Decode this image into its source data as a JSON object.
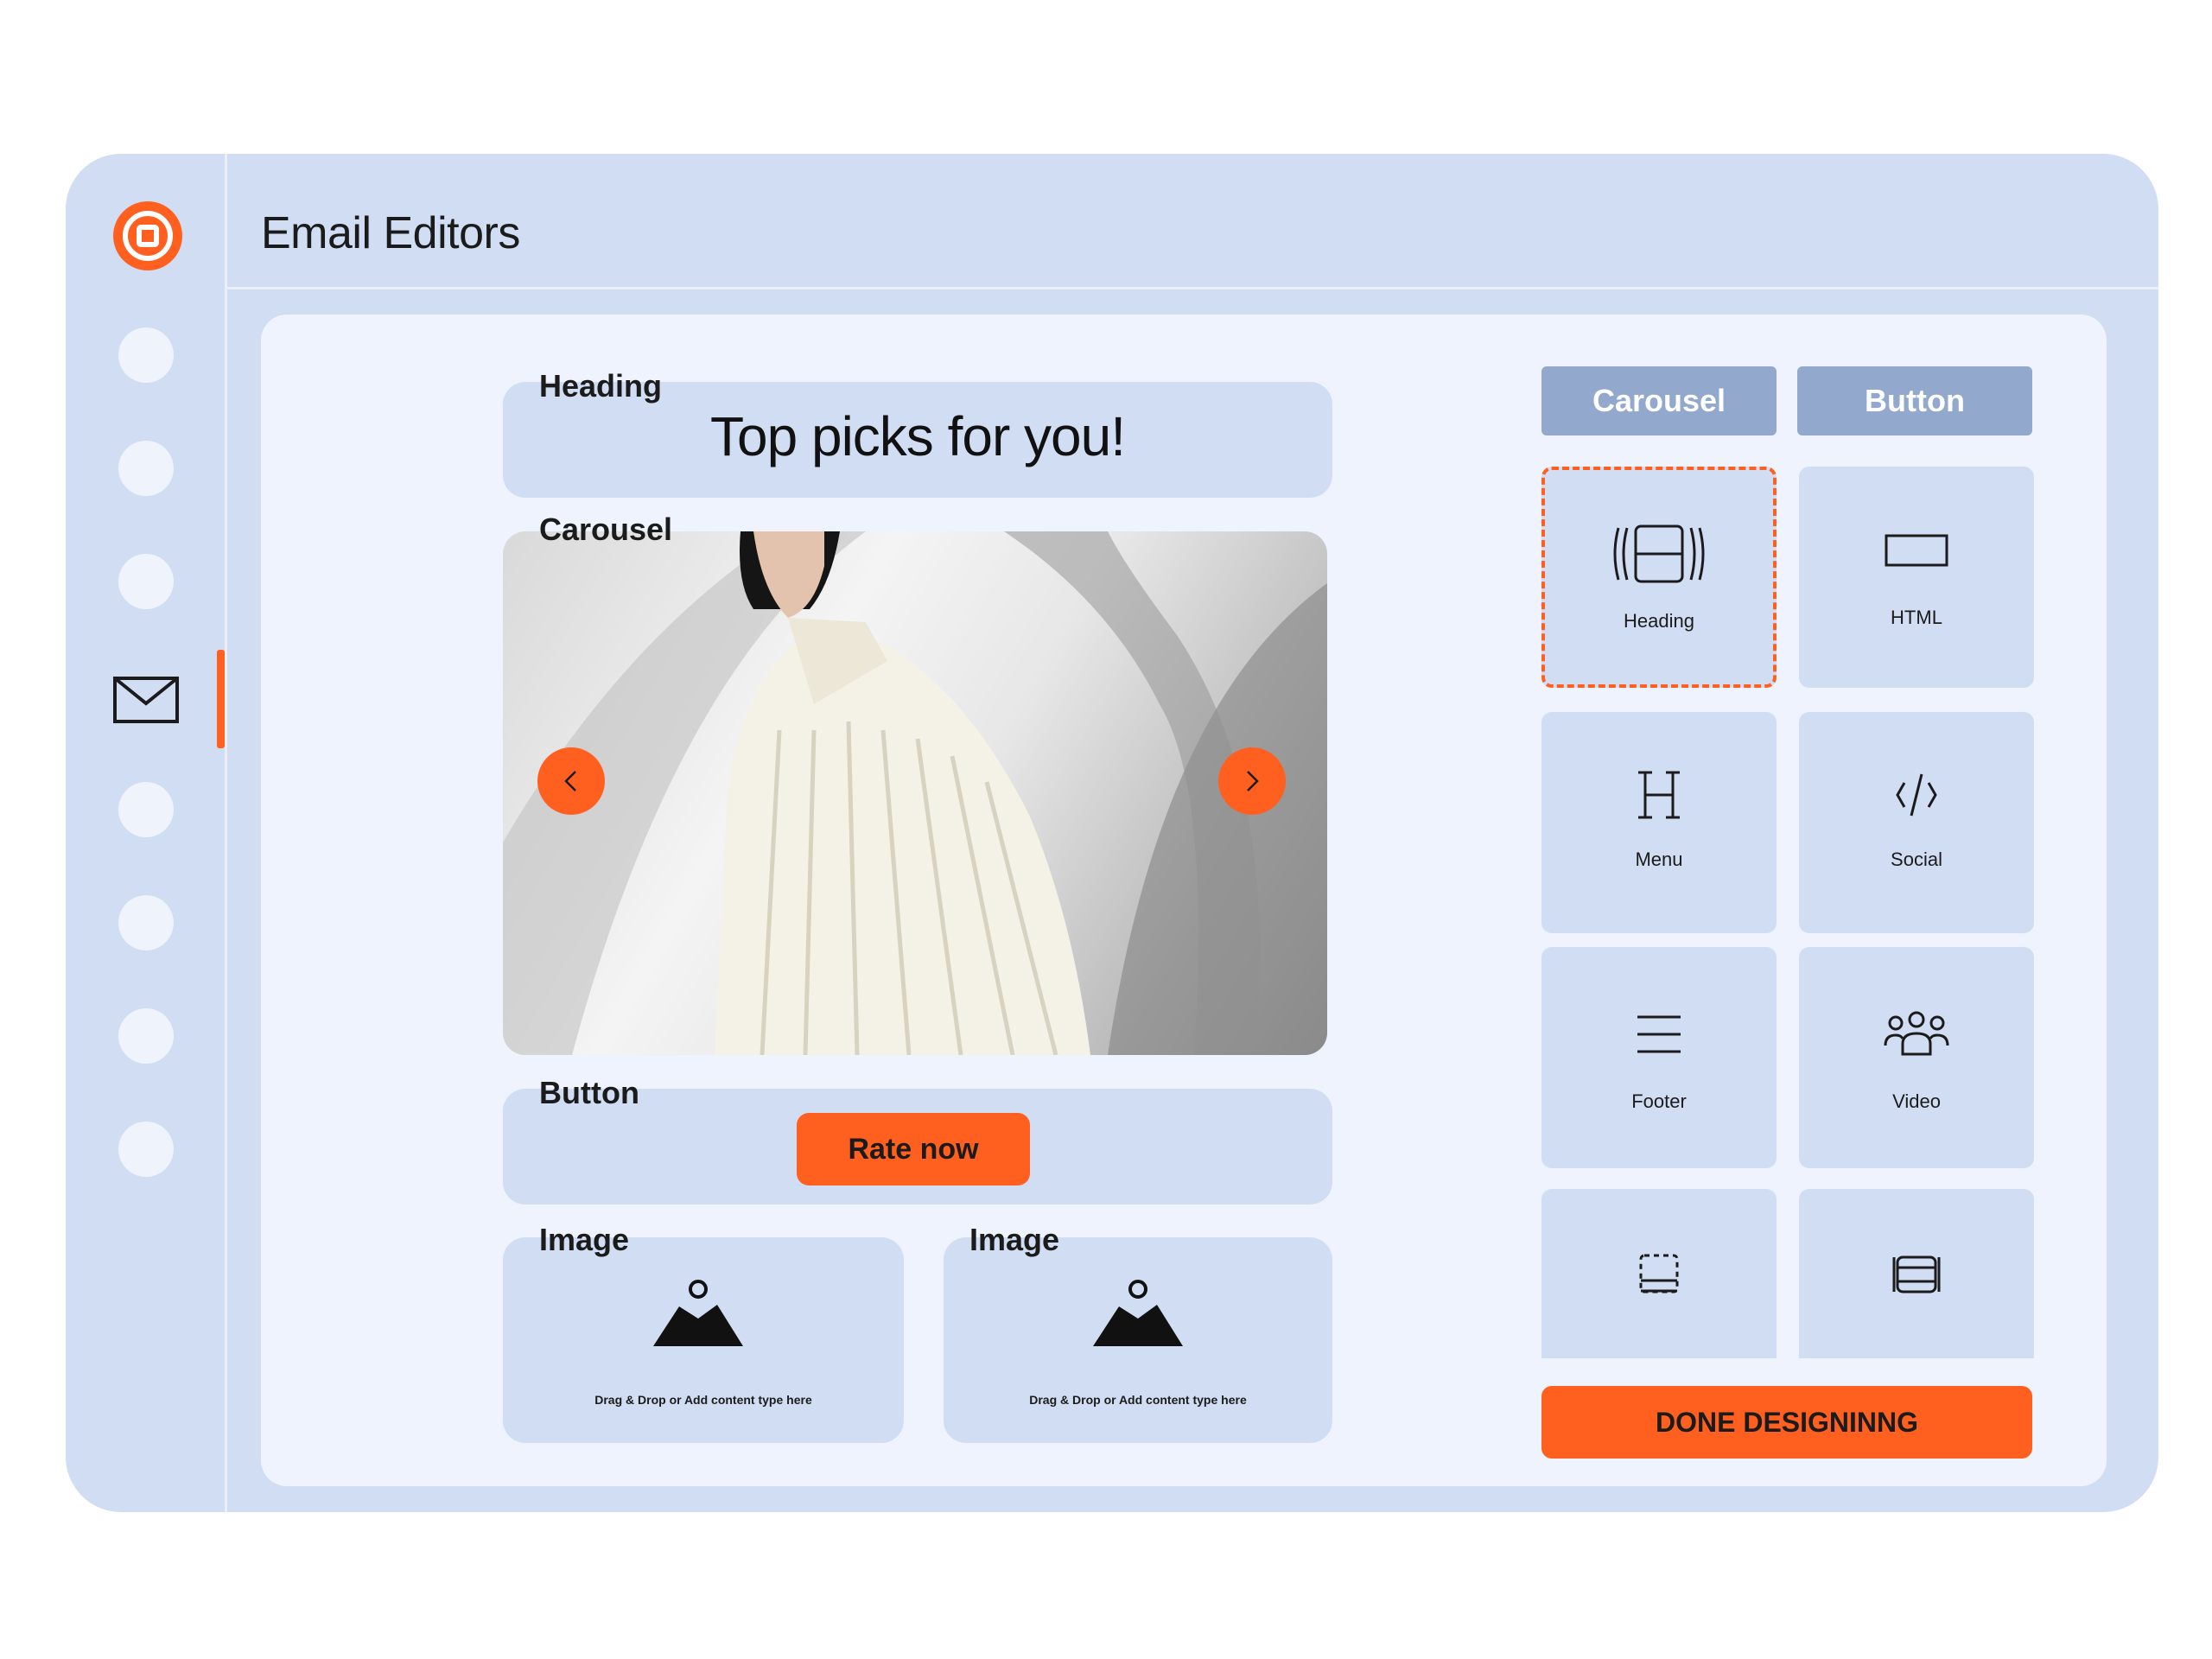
{
  "app": {
    "title": "Email Editors",
    "logo_icon": "target-logo-icon"
  },
  "sidebar": {
    "items": [
      {
        "icon": "nav-dot"
      },
      {
        "icon": "nav-dot"
      },
      {
        "icon": "nav-dot"
      },
      {
        "icon": "mail-icon",
        "active": true
      },
      {
        "icon": "nav-dot"
      },
      {
        "icon": "nav-dot"
      },
      {
        "icon": "nav-dot"
      },
      {
        "icon": "nav-dot"
      }
    ]
  },
  "editor": {
    "heading_block": {
      "label": "Heading",
      "text": "Top picks for you!"
    },
    "carousel_block": {
      "label": "Carousel",
      "prev_icon": "chevron-left-icon",
      "next_icon": "chevron-right-icon"
    },
    "button_block": {
      "label": "Button",
      "button_text": "Rate now"
    },
    "image_blocks": [
      {
        "label": "Image",
        "hint": "Drag & Drop or Add content type here"
      },
      {
        "label": "Image",
        "hint": "Drag & Drop or Add content type here"
      }
    ]
  },
  "palette": {
    "tabs": [
      {
        "label": "Carousel"
      },
      {
        "label": "Button"
      }
    ],
    "tiles": [
      {
        "label": "Heading",
        "icon": "carousel-icon",
        "selected": true
      },
      {
        "label": "HTML",
        "icon": "rectangle-icon"
      },
      {
        "label": "Menu",
        "icon": "heading-h-icon"
      },
      {
        "label": "Social",
        "icon": "code-icon"
      },
      {
        "label": "Footer",
        "icon": "menu-lines-icon"
      },
      {
        "label": "Video",
        "icon": "users-icon"
      },
      {
        "label": "",
        "icon": "footer-layout-icon"
      },
      {
        "label": "",
        "icon": "film-icon"
      }
    ],
    "done_label": "DONE DESIGNINNG"
  },
  "colors": {
    "accent": "#ff5f1f",
    "panel": "#d1ddf3",
    "canvas": "#eef3fd",
    "tab": "#93a8cd"
  }
}
